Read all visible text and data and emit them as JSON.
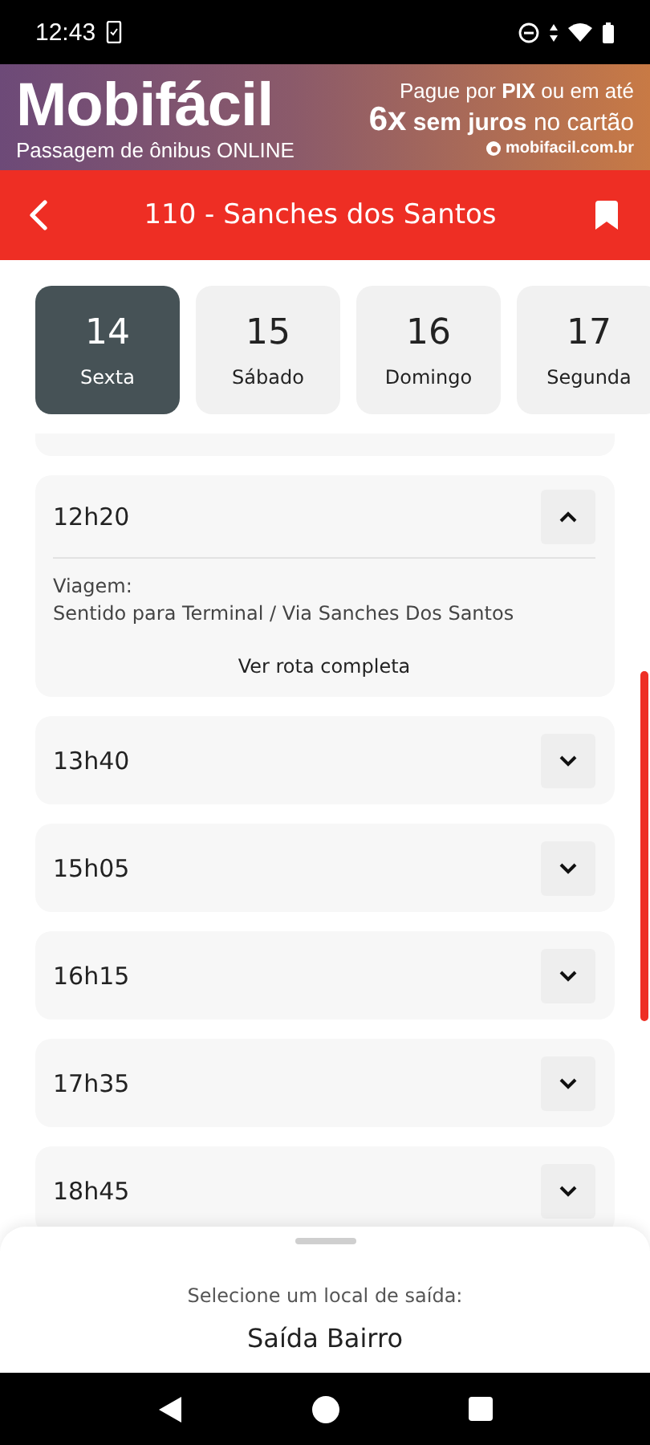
{
  "status_bar": {
    "time": "12:43"
  },
  "ad_banner": {
    "brand": "Mobifácil",
    "tagline": "Passagem de ônibus ONLINE",
    "offer_line_1": "Pague por **PIX** ou em até",
    "offer_line_2": "**6x** **sem juros** no cartão",
    "site": "mobifacil.com.br"
  },
  "header": {
    "title": "110 - Sanches dos Santos"
  },
  "days": [
    {
      "day": "14",
      "weekday": "Sexta",
      "selected": true
    },
    {
      "day": "15",
      "weekday": "Sábado",
      "selected": false
    },
    {
      "day": "16",
      "weekday": "Domingo",
      "selected": false
    },
    {
      "day": "17",
      "weekday": "Segunda",
      "selected": false
    }
  ],
  "departures": [
    {
      "time": "12h20",
      "expanded": true,
      "trip_label": "Viagem:",
      "trip": "Sentido para Terminal / Via Sanches Dos Santos",
      "route_link": "Ver rota completa"
    },
    {
      "time": "13h40",
      "expanded": false
    },
    {
      "time": "15h05",
      "expanded": false
    },
    {
      "time": "16h15",
      "expanded": false
    },
    {
      "time": "17h35",
      "expanded": false
    },
    {
      "time": "18h45",
      "expanded": false
    }
  ],
  "bottom_sheet": {
    "prompt": "Selecione um local de saída:",
    "selection": "Saída Bairro"
  }
}
